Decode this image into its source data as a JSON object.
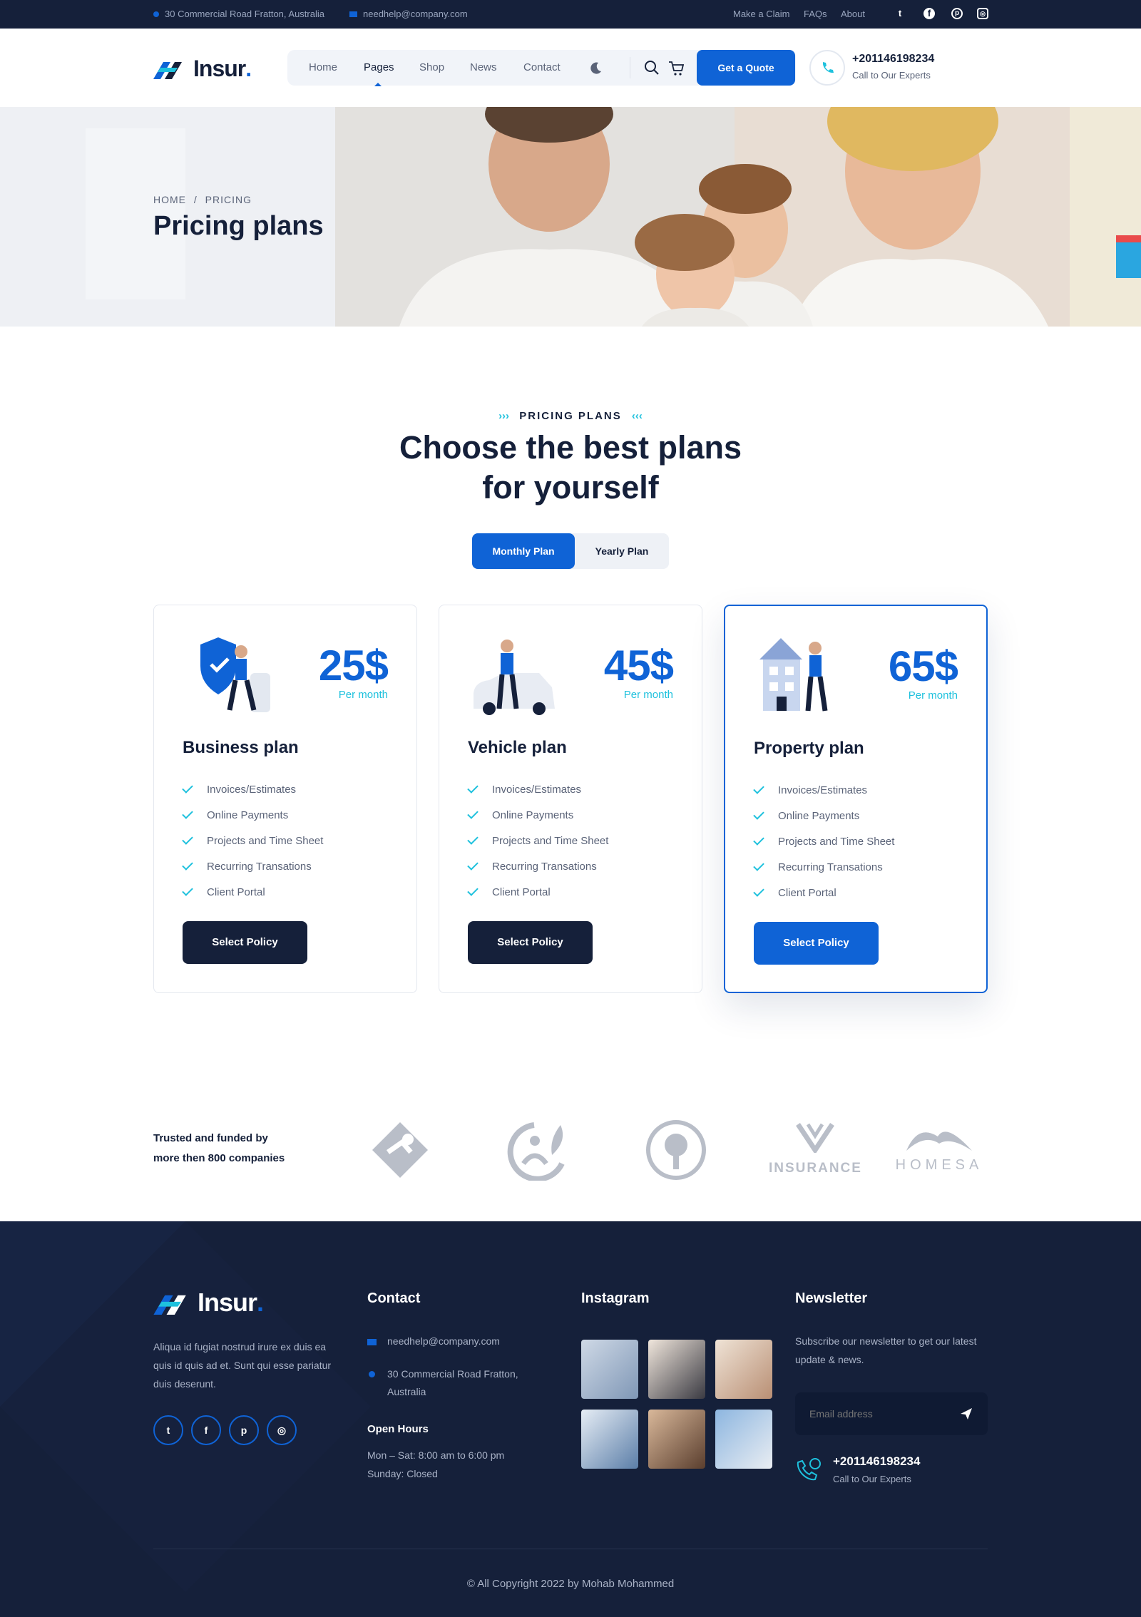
{
  "topbar": {
    "address": "30 Commercial Road Fratton, Australia",
    "email": "needhelp@company.com",
    "links": [
      "Make a Claim",
      "FAQs",
      "About"
    ],
    "social": [
      {
        "icon": "twitter-icon",
        "glyph": "t"
      },
      {
        "icon": "facebook-icon",
        "glyph": "f"
      },
      {
        "icon": "pinterest-icon",
        "glyph": "p"
      },
      {
        "icon": "instagram-icon",
        "glyph": "◎"
      }
    ]
  },
  "header": {
    "logo_text": "Insur",
    "nav": [
      {
        "label": "Home",
        "active": false
      },
      {
        "label": "Pages",
        "active": true
      },
      {
        "label": "Shop",
        "active": false
      },
      {
        "label": "News",
        "active": false
      },
      {
        "label": "Contact",
        "active": false
      }
    ],
    "quote_button": "Get a Quote",
    "phone": "+201146198234",
    "phone_caption": "Call to Our Experts"
  },
  "hero": {
    "breadcrumb_home": "HOME",
    "breadcrumb_sep": "/",
    "breadcrumb_current": "PRICING",
    "title": "Pricing plans"
  },
  "pricing": {
    "tag": "PRICING PLANS",
    "title_line1": "Choose the best plans",
    "title_line2": "for yourself",
    "toggle": [
      "Monthly Plan",
      "Yearly Plan"
    ],
    "plans": [
      {
        "price": "25$",
        "period": "Per month",
        "name": "Business plan",
        "button": "Select Policy",
        "features": [
          "Invoices/Estimates",
          "Online Payments",
          "Projects and Time Sheet",
          "Recurring Transations",
          "Client Portal"
        ]
      },
      {
        "price": "45$",
        "period": "Per month",
        "name": "Vehicle plan",
        "button": "Select Policy",
        "features": [
          "Invoices/Estimates",
          "Online Payments",
          "Projects and Time Sheet",
          "Recurring Transations",
          "Client Portal"
        ]
      },
      {
        "price": "65$",
        "period": "Per month",
        "name": "Property plan",
        "button": "Select Policy",
        "features": [
          "Invoices/Estimates",
          "Online Payments",
          "Projects and Time Sheet",
          "Recurring Transations",
          "Client Portal"
        ]
      }
    ]
  },
  "partners": {
    "line1": "Trusted and funded by",
    "line2": "more then 800 companies",
    "logo4_text": "INSURANCE",
    "logo5_text": "HOMESA"
  },
  "footer": {
    "logo_text": "Insur",
    "about": "Aliqua id fugiat nostrud irure ex duis ea quis id quis ad et. Sunt qui esse pariatur duis deserunt.",
    "contact_heading": "Contact",
    "email": "needhelp@company.com",
    "address_line1": "30 Commercial Road Fratton,",
    "address_line2": "Australia",
    "hours_heading": "Open Hours",
    "hours_line1": "Mon – Sat: 8:00 am to 6:00 pm",
    "hours_line2": "Sunday: Closed",
    "instagram_heading": "Instagram",
    "newsletter_heading": "Newsletter",
    "newsletter_text": "Subscribe our newsletter to get our latest update & news.",
    "email_placeholder": "Email address",
    "phone": "+201146198234",
    "phone_caption": "Call to Our Experts",
    "copyright": "© All Copyright 2022 by Mohab Mohammed"
  },
  "colors": {
    "primary": "#0f63d6",
    "accent": "#1ec1dd",
    "dark": "#15203a"
  }
}
